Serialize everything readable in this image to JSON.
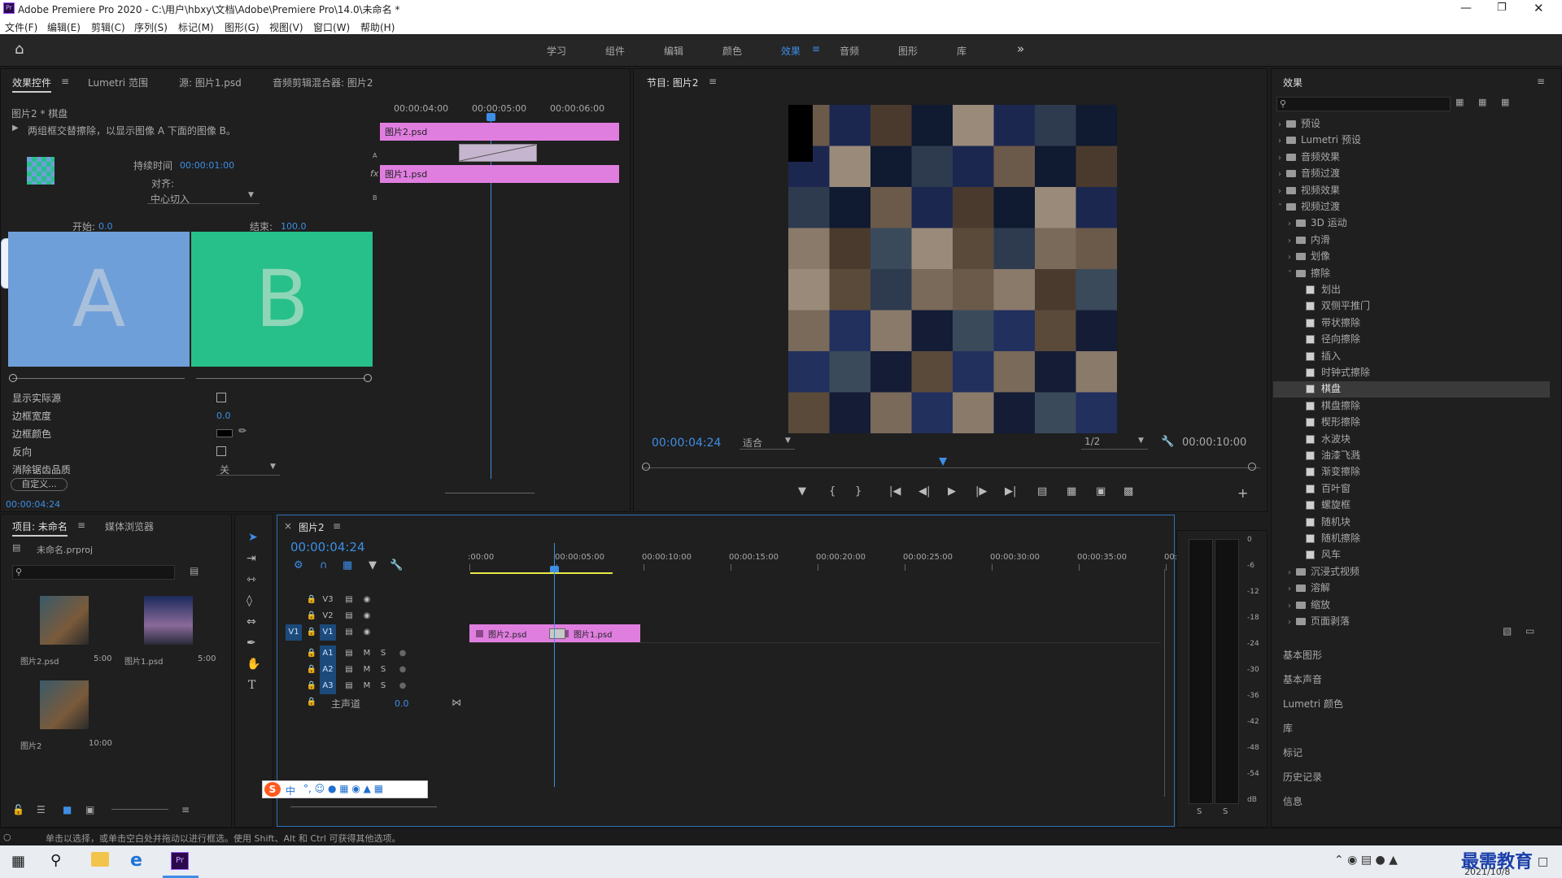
{
  "window": {
    "title": "Adobe Premiere Pro 2020 - C:\\用户\\hbxy\\文档\\Adobe\\Premiere Pro\\14.0\\未命名 *"
  },
  "menu": [
    "文件(F)",
    "编辑(E)",
    "剪辑(C)",
    "序列(S)",
    "标记(M)",
    "图形(G)",
    "视图(V)",
    "窗口(W)",
    "帮助(H)"
  ],
  "workspaces": [
    "学习",
    "组件",
    "编辑",
    "颜色",
    "效果",
    "音频",
    "图形",
    "库"
  ],
  "workspace_active": "效果",
  "effect_controls": {
    "tabs": [
      "效果控件",
      "Lumetri 范围",
      "源: 图片1.psd",
      "音频剪辑混合器: 图片2"
    ],
    "clip": "图片2 * 棋盘",
    "description": "两组框交替擦除，以显示图像 A 下面的图像 B。",
    "duration_label": "持续时间",
    "duration_value": "00:00:01:00",
    "align_label": "对齐:",
    "align_value": "中心切入",
    "start_label": "开始:",
    "start_value": "0.0",
    "end_label": "结束:",
    "end_value": "100.0",
    "a_label": "A",
    "b_label": "B",
    "props": [
      {
        "label": "显示实际源",
        "value": ""
      },
      {
        "label": "边框宽度",
        "value": "0.0"
      },
      {
        "label": "边框颜色",
        "value": ""
      },
      {
        "label": "反向",
        "value": ""
      },
      {
        "label": "消除锯齿品质",
        "value": "关"
      }
    ],
    "custom_button": "自定义...",
    "timecode": "00:00:04:24",
    "mini_ruler": [
      "00:00:04:00",
      "00:00:05:00",
      "00:00:06:00"
    ],
    "clip_a": "图片2.psd",
    "clip_b": "图片1.psd",
    "track_a": "A",
    "track_b": "B",
    "fx_badge": "fx"
  },
  "program": {
    "title": "节目: 图片2",
    "timecode": "00:00:04:24",
    "fit": "适合",
    "resolution": "1/2",
    "duration": "00:00:10:00",
    "playhead_fraction": 0.49
  },
  "effects_panel": {
    "title": "效果",
    "tree": [
      {
        "label": "预设",
        "level": 0,
        "type": "folder",
        "open": false
      },
      {
        "label": "Lumetri 预设",
        "level": 0,
        "type": "folder",
        "open": false
      },
      {
        "label": "音频效果",
        "level": 0,
        "type": "folder",
        "open": false
      },
      {
        "label": "音频过渡",
        "level": 0,
        "type": "folder",
        "open": false
      },
      {
        "label": "视频效果",
        "level": 0,
        "type": "folder",
        "open": false
      },
      {
        "label": "视频过渡",
        "level": 0,
        "type": "folder",
        "open": true
      },
      {
        "label": "3D 运动",
        "level": 1,
        "type": "folder",
        "open": false
      },
      {
        "label": "内滑",
        "level": 1,
        "type": "folder",
        "open": false
      },
      {
        "label": "划像",
        "level": 1,
        "type": "folder",
        "open": false
      },
      {
        "label": "擦除",
        "level": 1,
        "type": "folder",
        "open": true
      },
      {
        "label": "划出",
        "level": 2,
        "type": "fx"
      },
      {
        "label": "双侧平推门",
        "level": 2,
        "type": "fx"
      },
      {
        "label": "带状擦除",
        "level": 2,
        "type": "fx"
      },
      {
        "label": "径向擦除",
        "level": 2,
        "type": "fx"
      },
      {
        "label": "插入",
        "level": 2,
        "type": "fx"
      },
      {
        "label": "时钟式擦除",
        "level": 2,
        "type": "fx"
      },
      {
        "label": "棋盘",
        "level": 2,
        "type": "fx",
        "selected": true
      },
      {
        "label": "棋盘擦除",
        "level": 2,
        "type": "fx"
      },
      {
        "label": "楔形擦除",
        "level": 2,
        "type": "fx"
      },
      {
        "label": "水波块",
        "level": 2,
        "type": "fx"
      },
      {
        "label": "油漆飞溅",
        "level": 2,
        "type": "fx"
      },
      {
        "label": "渐变擦除",
        "level": 2,
        "type": "fx"
      },
      {
        "label": "百叶窗",
        "level": 2,
        "type": "fx"
      },
      {
        "label": "螺旋框",
        "level": 2,
        "type": "fx"
      },
      {
        "label": "随机块",
        "level": 2,
        "type": "fx"
      },
      {
        "label": "随机擦除",
        "level": 2,
        "type": "fx"
      },
      {
        "label": "风车",
        "level": 2,
        "type": "fx"
      },
      {
        "label": "沉浸式视频",
        "level": 1,
        "type": "folder",
        "open": false
      },
      {
        "label": "溶解",
        "level": 1,
        "type": "folder",
        "open": false
      },
      {
        "label": "缩放",
        "level": 1,
        "type": "folder",
        "open": false
      },
      {
        "label": "页面剥落",
        "level": 1,
        "type": "folder",
        "open": false
      }
    ],
    "sections": [
      "基本图形",
      "基本声音",
      "Lumetri 颜色",
      "库",
      "标记",
      "历史记录",
      "信息"
    ]
  },
  "project": {
    "tabs": [
      "项目: 未命名",
      "媒体浏览器"
    ],
    "file": "未命名.prproj",
    "items": [
      {
        "name": "图片2.psd",
        "duration": "5:00"
      },
      {
        "name": "图片1.psd",
        "duration": "5:00"
      },
      {
        "name": "图片2",
        "duration": "10:00"
      }
    ]
  },
  "timeline": {
    "title": "图片2",
    "timecode": "00:00:04:24",
    "ruler": [
      ":00:00",
      "00:00:05:00",
      "00:00:10:00",
      "00:00:15:00",
      "00:00:20:00",
      "00:00:25:00",
      "00:00:30:00",
      "00:00:35:00",
      "00:0"
    ],
    "video_tracks": [
      "V3",
      "V2",
      "V1"
    ],
    "audio_tracks": [
      "A1",
      "A2",
      "A3"
    ],
    "master_label": "主声道",
    "master_value": "0.0",
    "src_patch": "V1",
    "clip1": "图片2.psd",
    "clip2": "图片1.psd",
    "m": "M",
    "s": "S"
  },
  "meter": {
    "scale": [
      "0",
      "-6",
      "-12",
      "-18",
      "-24",
      "-30",
      "-36",
      "-42",
      "-48",
      "-54",
      "dB"
    ],
    "solo": [
      "S",
      "S"
    ]
  },
  "ime": {
    "label": "中"
  },
  "status": "单击以选择，或单击空白处并拖动以进行框选。使用 Shift、Alt 和 Ctrl 可获得其他选项。",
  "taskbar": {
    "date": "2021/10/8",
    "watermark": "最需教育"
  },
  "colors": {
    "accent": "#3d8ee6",
    "clip": "#e07ee0",
    "a_tile": "#6f9fd8",
    "b_tile": "#27c08a"
  }
}
